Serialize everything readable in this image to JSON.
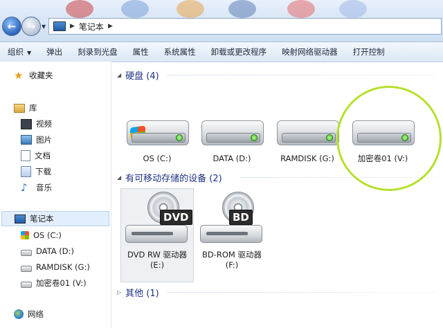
{
  "address": {
    "segments": [
      "笔记本"
    ]
  },
  "toolbar": {
    "items": [
      "组织",
      "弹出",
      "刻录到光盘",
      "属性",
      "系统属性",
      "卸载或更改程序",
      "映射网络驱动器",
      "打开控制"
    ]
  },
  "nav": {
    "favorites": "收藏夹",
    "library": "库",
    "library_items": [
      "视频",
      "图片",
      "文档",
      "下载",
      "音乐"
    ],
    "computer": "笔记本",
    "computer_items": [
      "OS (C:)",
      "DATA (D:)",
      "RAMDISK (G:)",
      "加密卷01 (V:)"
    ],
    "network": "网络"
  },
  "groups": {
    "hdd": "硬盘 (4)",
    "removable": "有可移动存储的设备 (2)",
    "other": "其他 (1)"
  },
  "drives": {
    "hdd": [
      "OS (C:)",
      "DATA (D:)",
      "RAMDISK (G:)",
      "加密卷01 (V:)"
    ],
    "removable": [
      {
        "line1": "DVD RW 驱动器",
        "line2": "(E:)",
        "badge": "DVD"
      },
      {
        "line1": "BD-ROM 驱动器",
        "line2": "(F:)",
        "badge": "BD"
      }
    ]
  },
  "colors": {
    "highlight_circle": "#b5e02c",
    "group_header": "#1e3287"
  }
}
